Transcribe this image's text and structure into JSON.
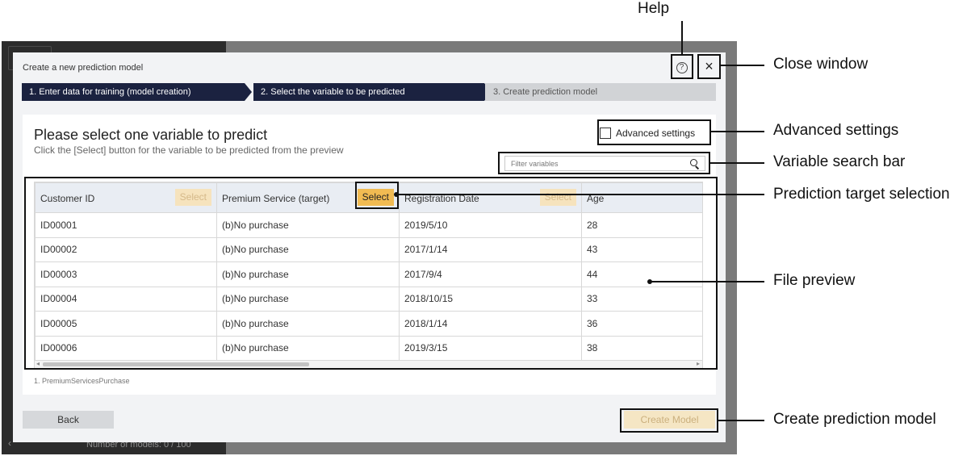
{
  "background": {
    "model_count": "Number of models: 0 / 100",
    "back_arrow": "‹"
  },
  "dialog": {
    "title": "Create a new prediction model",
    "help_symbol": "?",
    "close_symbol": "×",
    "steps": [
      {
        "label": "1. Enter data for training (model creation)",
        "state": "done"
      },
      {
        "label": "2. Select the variable to be predicted",
        "state": "current"
      },
      {
        "label": "3. Create prediction model",
        "state": "pending"
      }
    ],
    "heading": "Please select one variable to predict",
    "subheading": "Click the [Select] button for the variable to be predicted from the preview",
    "advanced_settings": {
      "label": "Advanced settings",
      "checked": false
    },
    "filter": {
      "placeholder": "Filter variables",
      "value": ""
    },
    "table": {
      "columns": [
        {
          "label": "Customer ID",
          "select": "Select",
          "selected": false
        },
        {
          "label": "Premium Service (target)",
          "select": "Select",
          "selected": true
        },
        {
          "label": "Registration Date",
          "select": "Select",
          "selected": false
        },
        {
          "label": "Age",
          "select": "",
          "selected": false
        }
      ],
      "rows": [
        [
          "ID00001",
          "(b)No purchase",
          "2019/5/10",
          "28"
        ],
        [
          "ID00002",
          "(b)No purchase",
          "2017/1/14",
          "43"
        ],
        [
          "ID00003",
          "(b)No purchase",
          "2017/9/4",
          "44"
        ],
        [
          "ID00004",
          "(b)No purchase",
          "2018/10/15",
          "33"
        ],
        [
          "ID00005",
          "(b)No purchase",
          "2018/1/14",
          "36"
        ],
        [
          "ID00006",
          "(b)No purchase",
          "2019/3/15",
          "38"
        ]
      ]
    },
    "file_caption": "1. PremiumServicesPurchase",
    "back_label": "Back",
    "create_label": "Create Model"
  },
  "callouts": {
    "help": "Help",
    "close": "Close window",
    "advanced": "Advanced settings",
    "search": "Variable search bar",
    "target": "Prediction target selection",
    "preview": "File preview",
    "create": "Create prediction model"
  },
  "colors": {
    "step_active": "#1b2240",
    "step_pending": "#d1d3d6",
    "select_active": "#f1bb52",
    "select_inactive": "#f6e3bd",
    "dialog_bg": "#f2f3f5"
  }
}
